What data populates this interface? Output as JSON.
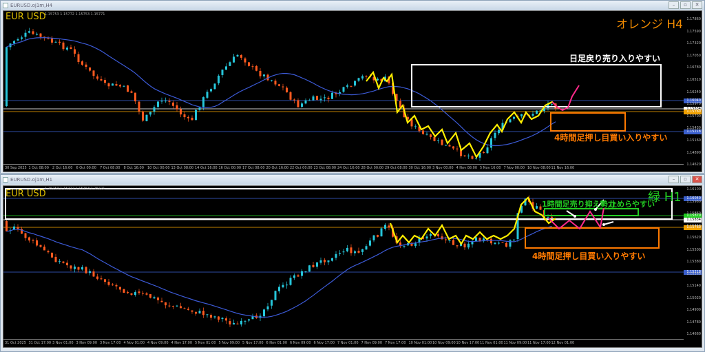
{
  "windows": [
    {
      "title": "EURUSD.oj1m,H4",
      "symbol": "EUR USD",
      "ohlc": "1.15753 1.15772 1.15753 1.15771",
      "timeframe_note": "オレンジ H4",
      "annotations": {
        "daily": "日足戻り売り入りやすい",
        "h4": "4時間足押し目買い入りやすい"
      },
      "price_labels": [
        "1.17860",
        "1.17590",
        "1.17320",
        "1.17050",
        "1.16780",
        "1.16510",
        "1.16240",
        "1.15970",
        "1.15700",
        "1.15430",
        "1.15160",
        "1.14890",
        "1.14620"
      ],
      "levels": [
        {
          "value": "1.16040",
          "color": "#3a5fcd"
        },
        {
          "value": "1.15834",
          "color": "#ffffff"
        },
        {
          "value": "1.15760",
          "color": "#f0a000"
        },
        {
          "value": "1.15218",
          "color": "#3a5fcd"
        }
      ],
      "time_labels": [
        "30 Sep 2025",
        "1 Oct 08:00",
        "2 Oct 16:00",
        "6 Oct 00:00",
        "7 Oct 08:00",
        "8 Oct 16:00",
        "10 Oct 00:00",
        "13 Oct 08:00",
        "14 Oct 16:00",
        "16 Oct 00:00",
        "17 Oct 08:00",
        "20 Oct 16:00",
        "22 Oct 00:00",
        "23 Oct 08:00",
        "24 Oct 16:00",
        "28 Oct 00:00",
        "29 Oct 08:00",
        "30 Oct 16:00",
        "3 Nov 00:00",
        "4 Nov 08:00",
        "5 Nov 16:00",
        "7 Nov 00:00",
        "10 Nov 08:00",
        "11 Nov 16:00"
      ]
    },
    {
      "title": "EURUSD.oj1m,H1",
      "symbol": "EUR USD",
      "ohlc": "1.15753 1.15772 1.15753 1.15771",
      "timeframe_note": "緑 H1",
      "annotations": {
        "h1": "1時間足売り抑え勢力",
        "h1b": "止めらやすい",
        "h4": "4時間足押し目買い入りやすい"
      },
      "price_labels": [
        "1.16100",
        "1.15980",
        "1.15860",
        "1.15740",
        "1.15620",
        "1.15500",
        "1.15380",
        "1.15260",
        "1.15140",
        "1.15020",
        "1.14900",
        "1.14780",
        "1.14660"
      ],
      "levels": [
        {
          "value": "1.16040",
          "color": "#3a5fcd"
        },
        {
          "value": "1.15870",
          "color": "#22cc22"
        },
        {
          "value": "1.15834",
          "color": "#ffffff"
        },
        {
          "value": "1.15760",
          "color": "#f0a000"
        },
        {
          "value": "1.15218",
          "color": "#3a5fcd"
        }
      ],
      "time_labels": [
        "31 Oct 2025",
        "31 Oct 17:00",
        "3 Nov 01:00",
        "3 Nov 09:00",
        "3 Nov 17:00",
        "4 Nov 01:00",
        "4 Nov 09:00",
        "4 Nov 17:00",
        "5 Nov 01:00",
        "5 Nov 09:00",
        "5 Nov 17:00",
        "6 Nov 01:00",
        "6 Nov 09:00",
        "6 Nov 17:00",
        "7 Nov 01:00",
        "7 Nov 09:00",
        "7 Nov 17:00",
        "10 Nov 01:00",
        "10 Nov 09:00",
        "10 Nov 17:00",
        "11 Nov 01:00",
        "11 Nov 09:00",
        "11 Nov 17:00",
        "12 Nov 01:00"
      ]
    }
  ],
  "colors": {
    "bull": "#26c6da",
    "bear": "#ff5a1f",
    "ma": "#3c5ad6",
    "zigzag": "#ffee00",
    "forecast": "#ff2a8a",
    "white_zone": "#ffffff",
    "orange_zone": "#ff7a00",
    "green_zone": "#22cc22"
  }
}
